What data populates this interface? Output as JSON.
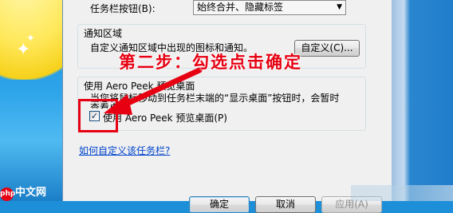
{
  "taskbar": {
    "buttons_label": "任务栏按钮(B):",
    "buttons_value": "始终合并、隐藏标签"
  },
  "notification": {
    "heading": "通知区域",
    "description": "自定义通知区域中出现的图标和通知。",
    "customize_label": "自定义(C)..."
  },
  "aero_peek": {
    "heading": "使用 Aero Peek 预览桌面",
    "description_line1": "当您将鼠标移动到任务栏末端的“显示桌面”按钮时，会暂时",
    "description_line2": "查看桌面。",
    "checkbox_label": "使用 Aero Peek 预览桌面(P)",
    "checked": true
  },
  "link_text": "如何自定义该任务栏?",
  "buttons": {
    "ok": "确定",
    "cancel": "取消",
    "apply": "应用(A)"
  },
  "annotation": "第二步：勾选点击确定",
  "watermark": "php中文网",
  "colors": {
    "annotation": "#e60012",
    "link": "#0044cc",
    "dialog_bg": "#f0f0f0"
  }
}
